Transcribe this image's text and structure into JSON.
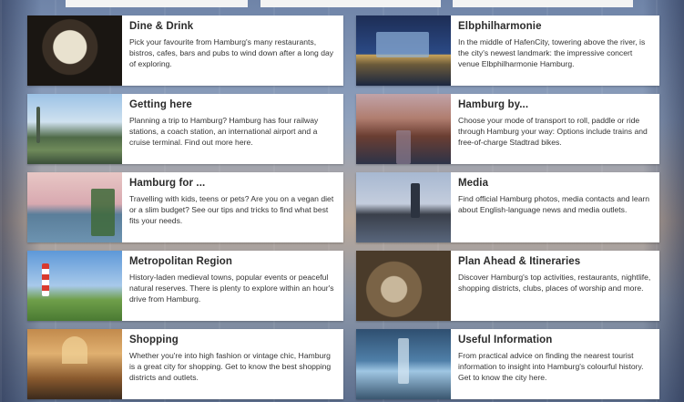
{
  "cards": [
    {
      "title": "Dine & Drink",
      "description": "Pick your favourite from Hamburg's many restaurants, bistros, cafes, bars and pubs to wind down after a long day of exploring.",
      "image": "food-bowl-photo"
    },
    {
      "title": "Elbphilharmonie",
      "description": "In the middle of HafenCity, towering above the river, is the city's newest landmark: the impressive concert venue Elbphilharmonie Hamburg.",
      "image": "elbphilharmonie-photo"
    },
    {
      "title": "Getting here",
      "description": "Planning a trip to Hamburg? Hamburg has four railway stations, a coach station, an international airport and a cruise terminal. Find out more here.",
      "image": "harbour-church-photo"
    },
    {
      "title": "Hamburg by...",
      "description": "Choose your mode of transport to roll, paddle or ride through Hamburg your way: Options include trains and free-of-charge Stadtrad bikes.",
      "image": "speicherstadt-canal-photo"
    },
    {
      "title": "Hamburg for ...",
      "description": "Travelling with kids, teens or pets? Are you on a vegan diet or a slim budget? See our tips and tricks to find what best fits your needs.",
      "image": "harbour-dusk-photo"
    },
    {
      "title": "Media",
      "description": "Find official Hamburg photos, media contacts and learn about English-language news and media outlets.",
      "image": "harbour-cranes-photo"
    },
    {
      "title": "Metropolitan Region",
      "description": "History-laden medieval towns, popular events or peaceful natural reserves. There is plenty to explore within an hour's drive from Hamburg.",
      "image": "lighthouse-photo"
    },
    {
      "title": "Plan Ahead & Itineraries",
      "description": "Discover Hamburg's top activities, restaurants, nightlife, shopping districts, clubs, places of worship and more.",
      "image": "cafe-table-photo"
    },
    {
      "title": "Shopping",
      "description": "Whether you're into high fashion or vintage chic, Hamburg is a great city for shopping. Get to know the best shopping districts and outlets.",
      "image": "shopping-arcade-photo"
    },
    {
      "title": "Useful Information",
      "description": "From practical advice on finding the nearest tourist information to insight into Hamburg's colourful history. Get to know the city here.",
      "image": "subway-station-photo"
    }
  ]
}
